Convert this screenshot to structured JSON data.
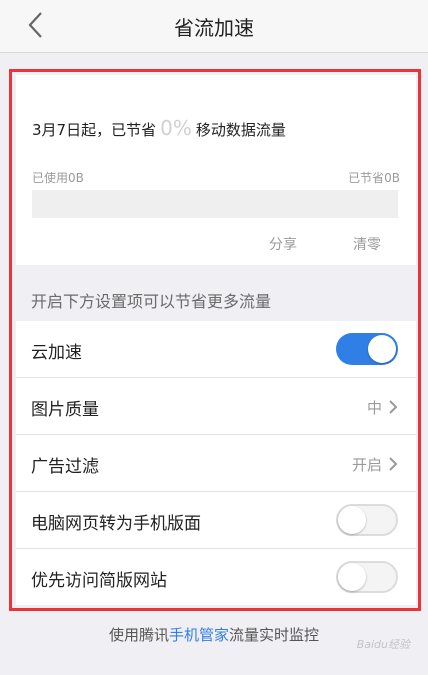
{
  "header": {
    "title": "省流加速",
    "back_icon": "chevron-left-icon"
  },
  "summary": {
    "prefix": "3月7日起，已节省",
    "percent": "0%",
    "suffix": "移动数据流量",
    "used_label": "已使用0B",
    "saved_label": "已节省0B",
    "saved_fraction": 0,
    "share_label": "分享",
    "clear_label": "清零",
    "percent_color": "#d0d0d0"
  },
  "section_hint": "开启下方设置项可以节省更多流量",
  "settings": [
    {
      "label": "云加速",
      "type": "toggle",
      "on": true
    },
    {
      "label": "图片质量",
      "type": "value",
      "value": "中"
    },
    {
      "label": "广告过滤",
      "type": "value",
      "value": "开启"
    },
    {
      "label": "电脑网页转为手机版面",
      "type": "toggle",
      "on": false
    },
    {
      "label": "优先访问简版网站",
      "type": "toggle",
      "on": false
    }
  ],
  "footer": {
    "text_before": "使用腾讯",
    "link_text": "手机管家",
    "text_after": "流量实时监控"
  },
  "colors": {
    "accent": "#2f7fe6",
    "highlight_frame": "#e8343a"
  }
}
